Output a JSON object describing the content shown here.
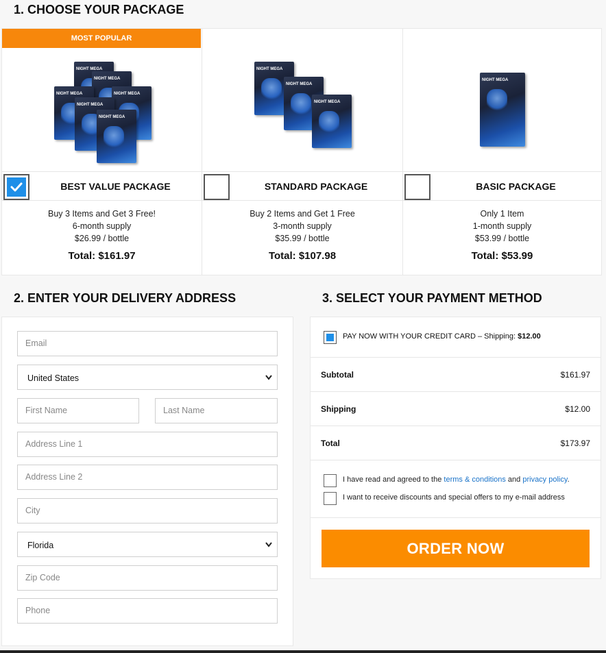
{
  "sections": {
    "package_heading": "1. CHOOSE YOUR PACKAGE",
    "address_heading": "2. ENTER YOUR DELIVERY ADDRESS",
    "payment_heading": "3. SELECT YOUR PAYMENT METHOD"
  },
  "packages": [
    {
      "badge": "MOST POPULAR",
      "name": "BEST VALUE PACKAGE",
      "selected": true,
      "line1": "Buy 3 Items and Get 3 Free!",
      "line2": "6-month supply",
      "line3": "$26.99 / bottle",
      "total": "Total: $161.97"
    },
    {
      "name": "STANDARD PACKAGE",
      "selected": false,
      "line1": "Buy 2 Items and Get 1 Free",
      "line2": "3-month supply",
      "line3": "$35.99 / bottle",
      "total": "Total: $107.98"
    },
    {
      "name": "BASIC PACKAGE",
      "selected": false,
      "line1": "Only 1 Item",
      "line2": "1-month supply",
      "line3": "$53.99 / bottle",
      "total": "Total: $53.99"
    }
  ],
  "address_form": {
    "email_placeholder": "Email",
    "country_value": "United States",
    "first_name_placeholder": "First Name",
    "last_name_placeholder": "Last Name",
    "address1_placeholder": "Address Line 1",
    "address2_placeholder": "Address Line 2",
    "city_placeholder": "City",
    "state_value": "Florida",
    "zip_placeholder": "Zip Code",
    "phone_placeholder": "Phone"
  },
  "payment": {
    "method_label": "PAY NOW WITH YOUR CREDIT CARD – Shipping: ",
    "method_shipping": "$12.00",
    "method_selected": true,
    "subtotal_label": "Subtotal",
    "subtotal_value": "$161.97",
    "shipping_label": "Shipping",
    "shipping_value": "$12.00",
    "total_label": "Total",
    "total_value": "$173.97",
    "terms_prefix": "I have read and agreed to the ",
    "terms_link": "terms & conditions",
    "terms_mid": " and ",
    "privacy_link": "privacy policy",
    "terms_suffix": ".",
    "offers_text": "I want to receive discounts and special offers to my e-mail address",
    "order_button": "ORDER NOW"
  },
  "colors": {
    "accent_orange": "#fb8c00",
    "badge_orange": "#f7870b",
    "check_blue": "#1e8fe8",
    "link_blue": "#1a73c9"
  }
}
